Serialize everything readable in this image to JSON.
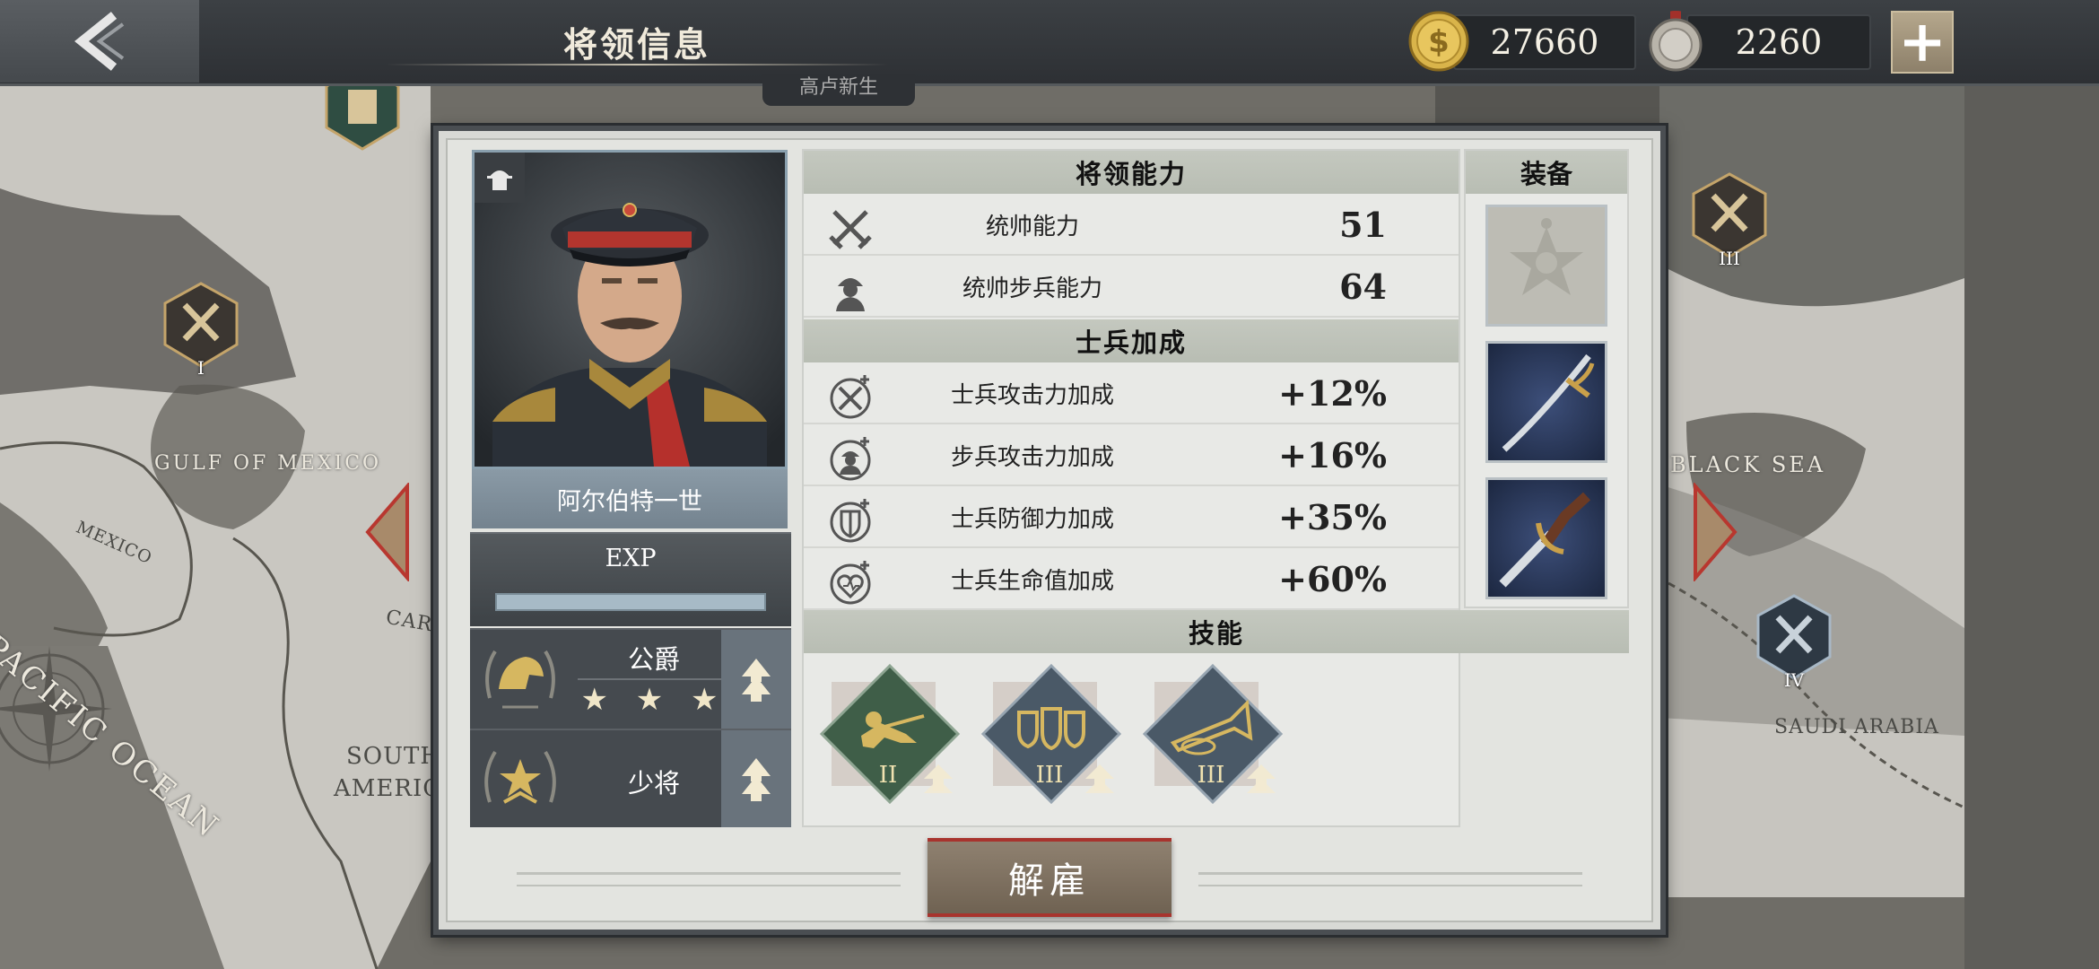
{
  "header": {
    "title": "将领信息"
  },
  "currency": {
    "gold": "27660",
    "medals": "2260"
  },
  "map": {
    "labels": {
      "gulf": "GULF OF MEXICO",
      "mexico": "MEXICO",
      "pacific": "PACIFIC OCEAN",
      "south_america_1": "SOUTH",
      "south_america_2": "AMERICA",
      "black_sea": "BLACK SEA",
      "saudi": "SAUDI ARABIA",
      "caribbean": "CAR"
    },
    "markers": [
      "I",
      "III",
      "IV"
    ],
    "behind_panel_text": "高卢新生"
  },
  "general": {
    "name": "阿尔伯特一世",
    "exp_label": "EXP",
    "exp_progress": 0.0,
    "title_rank": "公爵",
    "title_stars": "★ ★ ★",
    "military_rank": "少将"
  },
  "abilities": {
    "heading": "将领能力",
    "rows": [
      {
        "name": "统帅能力",
        "value": "51",
        "icon": "crossed-swords-icon"
      },
      {
        "name": "统帅步兵能力",
        "value": "64",
        "icon": "infantry-icon"
      }
    ]
  },
  "bonuses": {
    "heading": "士兵加成",
    "rows": [
      {
        "name": "士兵攻击力加成",
        "value": "+12%",
        "icon": "attack-bonus-icon"
      },
      {
        "name": "步兵攻击力加成",
        "value": "+16%",
        "icon": "infantry-bonus-icon"
      },
      {
        "name": "士兵防御力加成",
        "value": "+35%",
        "icon": "defense-bonus-icon"
      },
      {
        "name": "士兵生命值加成",
        "value": "+60%",
        "icon": "health-bonus-icon"
      }
    ]
  },
  "equipment": {
    "heading": "装备",
    "items": [
      "order-medal-icon",
      "sabre-icon",
      "dagger-icon"
    ]
  },
  "skills": {
    "heading": "技能",
    "items": [
      {
        "level": "II",
        "icon": "infantry-charge-icon",
        "color": "#3f5e48"
      },
      {
        "level": "III",
        "icon": "shields-icon",
        "color": "#4a5967"
      },
      {
        "level": "III",
        "icon": "bugle-icon",
        "color": "#4a5967"
      }
    ]
  },
  "actions": {
    "dismiss": "解雇"
  },
  "colors": {
    "panel_border": "#4a4e52",
    "accent_red": "#a8342e",
    "gold": "#c9a04a"
  }
}
